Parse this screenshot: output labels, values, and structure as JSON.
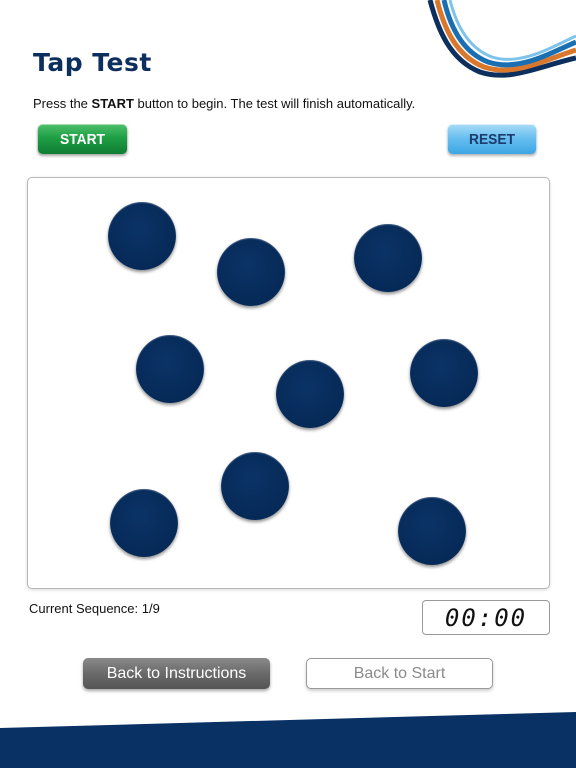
{
  "header": {
    "title": "Tap Test",
    "instructions_prefix": "Press the ",
    "instructions_bold": "START",
    "instructions_suffix": " button to begin. The test will finish automatically."
  },
  "controls": {
    "start_label": "START",
    "reset_label": "RESET"
  },
  "tap_area": {
    "target_count": 9
  },
  "status": {
    "sequence_label": "Current Sequence: 1/9",
    "timer": "00:00"
  },
  "navigation": {
    "back_to_instructions": "Back to Instructions",
    "back_to_start": "Back to Start"
  },
  "colors": {
    "brand_navy": "#0d2f5e",
    "target_fill": "#062a58",
    "start_green": "#1f9f45",
    "reset_blue": "#63bdef",
    "footer_navy": "#0a3163",
    "ribbon_orange": "#d9782d",
    "ribbon_blue": "#1a6fb3"
  }
}
